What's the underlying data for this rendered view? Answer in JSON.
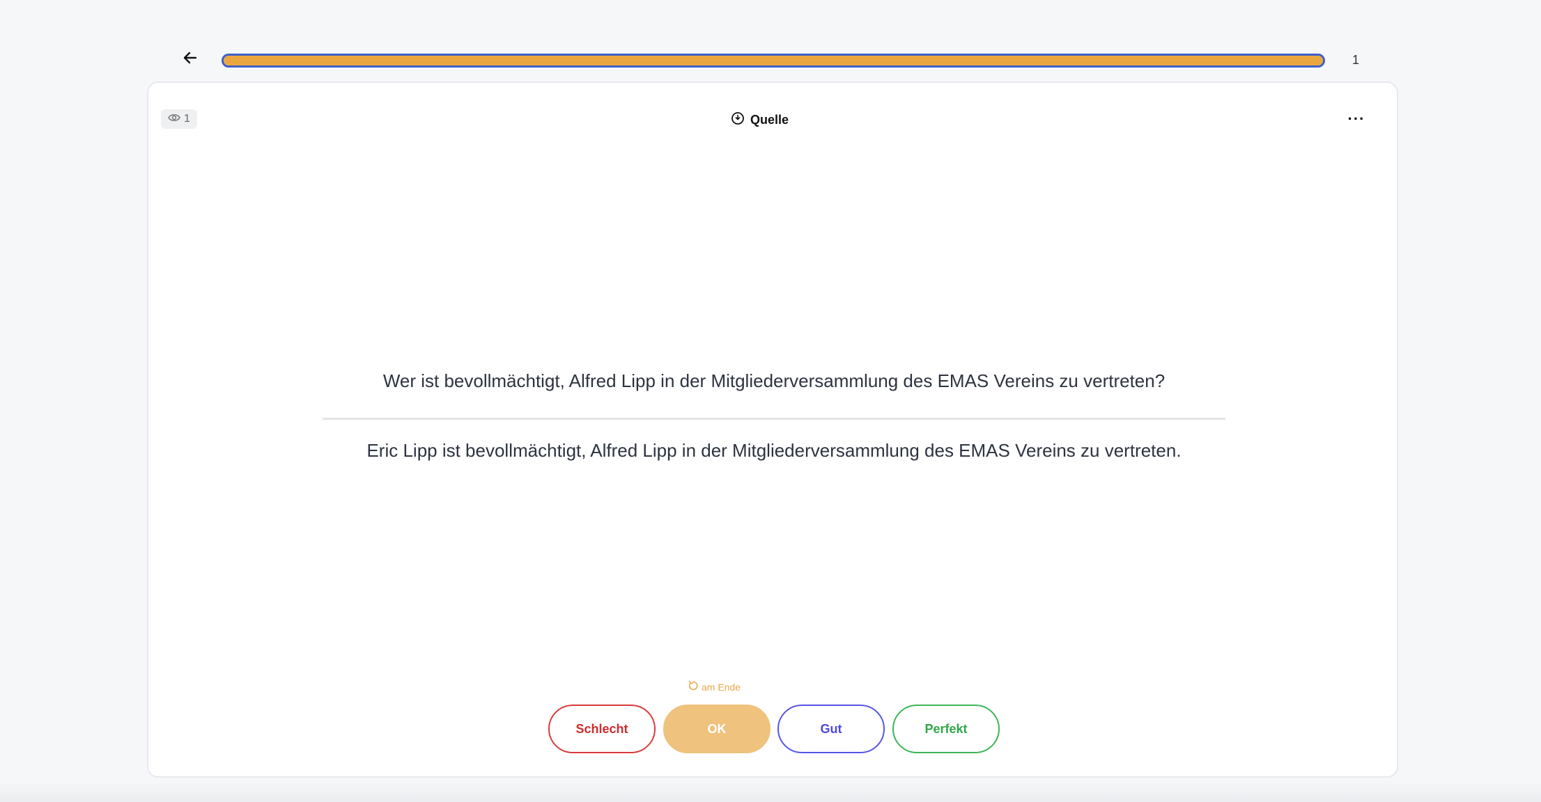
{
  "progress": {
    "fraction": 1.0,
    "counter": "1"
  },
  "card": {
    "views": "1",
    "source_label": "Quelle",
    "more_label": "···",
    "question": "Wer ist bevollmächtigt, Alfred Lipp in der Mitgliederversammlung des EMAS Vereins zu vertreten?",
    "answer": "Eric Lipp ist bevollmächtigt, Alfred Lipp in der Mitgliederversammlung des EMAS Vereins zu vertreten."
  },
  "repeat_hint": "am Ende",
  "ratings": {
    "bad": "Schlecht",
    "ok": "OK",
    "good": "Gut",
    "perfect": "Perfekt"
  },
  "colors": {
    "progress_fill": "#eba73f",
    "progress_border": "#3d5fc9",
    "bad": "#d93a3a",
    "ok": "#efc27d",
    "good": "#5654e6",
    "perfect": "#3db455"
  }
}
